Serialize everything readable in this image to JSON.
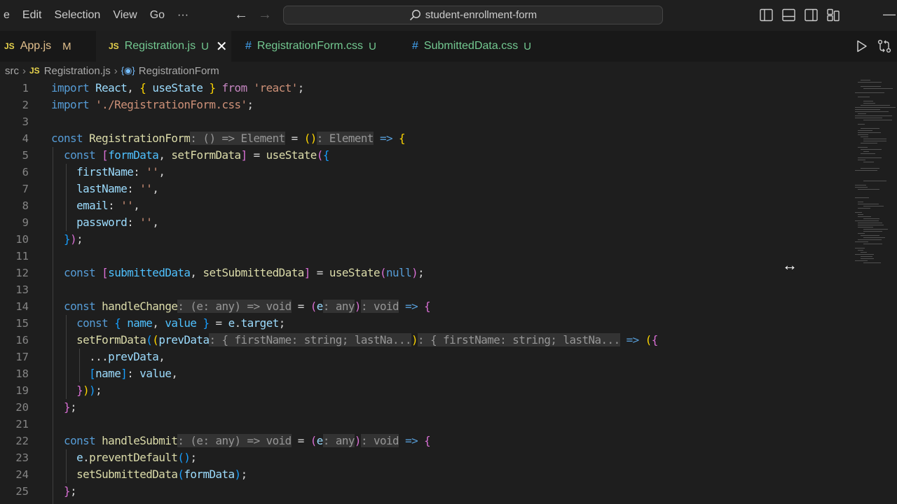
{
  "menu": [
    "e",
    "Edit",
    "Selection",
    "View",
    "Go",
    "···"
  ],
  "search": {
    "text": "student-enrollment-form",
    "icon": "search-icon"
  },
  "window_controls": {
    "minimize": "—"
  },
  "tabs": [
    {
      "icon": "JS",
      "name": "App.js",
      "status": "M",
      "active": false
    },
    {
      "icon": "JS",
      "name": "Registration.js",
      "status": "U",
      "active": true,
      "close": "✕"
    },
    {
      "icon": "#",
      "name": "RegistrationForm.css",
      "status": "U",
      "active": false
    },
    {
      "icon": "#",
      "name": "SubmittedData.css",
      "status": "U",
      "active": false
    }
  ],
  "breadcrumbs": {
    "folder": "src",
    "file_icon": "JS",
    "file": "Registration.js",
    "symbol_icon": "{◉}",
    "symbol": "RegistrationForm"
  },
  "line_numbers": [
    "1",
    "2",
    "3",
    "4",
    "5",
    "6",
    "7",
    "8",
    "9",
    "10",
    "11",
    "12",
    "13",
    "14",
    "15",
    "16",
    "17",
    "18",
    "19",
    "20",
    "21",
    "22",
    "23",
    "24",
    "25"
  ],
  "code": [
    [
      [
        "kw",
        "import "
      ],
      [
        "var",
        "React"
      ],
      [
        "pl",
        ", "
      ],
      [
        "br1",
        "{"
      ],
      [
        "var",
        " useState "
      ],
      [
        "br1",
        "}"
      ],
      [
        "ctl",
        " from "
      ],
      [
        "str",
        "'react'"
      ],
      [
        "pl",
        ";"
      ]
    ],
    [
      [
        "kw",
        "import "
      ],
      [
        "str",
        "'./RegistrationForm.css'"
      ],
      [
        "pl",
        ";"
      ]
    ],
    [],
    [
      [
        "kw",
        "const "
      ],
      [
        "fn",
        "RegistrationForm"
      ],
      [
        "hint",
        ": () => Element"
      ],
      [
        "pl",
        " = "
      ],
      [
        "br1",
        "()"
      ],
      [
        "hint",
        ": Element"
      ],
      [
        "kw",
        " => "
      ],
      [
        "br1",
        "{"
      ]
    ],
    [
      [
        "pl",
        "  "
      ],
      [
        "kw",
        "const "
      ],
      [
        "br2",
        "["
      ],
      [
        "cst",
        "formData"
      ],
      [
        "pl",
        ", "
      ],
      [
        "fn",
        "setFormData"
      ],
      [
        "br2",
        "]"
      ],
      [
        "pl",
        " = "
      ],
      [
        "fn",
        "useState"
      ],
      [
        "br2",
        "("
      ],
      [
        "br3",
        "{"
      ]
    ],
    [
      [
        "pl",
        "    "
      ],
      [
        "var",
        "firstName"
      ],
      [
        "pl",
        ": "
      ],
      [
        "str",
        "''"
      ],
      [
        "pl",
        ","
      ]
    ],
    [
      [
        "pl",
        "    "
      ],
      [
        "var",
        "lastName"
      ],
      [
        "pl",
        ": "
      ],
      [
        "str",
        "''"
      ],
      [
        "pl",
        ","
      ]
    ],
    [
      [
        "pl",
        "    "
      ],
      [
        "var",
        "email"
      ],
      [
        "pl",
        ": "
      ],
      [
        "str",
        "''"
      ],
      [
        "pl",
        ","
      ]
    ],
    [
      [
        "pl",
        "    "
      ],
      [
        "var",
        "password"
      ],
      [
        "pl",
        ": "
      ],
      [
        "str",
        "''"
      ],
      [
        "pl",
        ","
      ]
    ],
    [
      [
        "pl",
        "  "
      ],
      [
        "br3",
        "}"
      ],
      [
        "br2",
        ")"
      ],
      [
        "pl",
        ";"
      ]
    ],
    [],
    [
      [
        "pl",
        "  "
      ],
      [
        "kw",
        "const "
      ],
      [
        "br2",
        "["
      ],
      [
        "cst",
        "submittedData"
      ],
      [
        "pl",
        ", "
      ],
      [
        "fn",
        "setSubmittedData"
      ],
      [
        "br2",
        "]"
      ],
      [
        "pl",
        " = "
      ],
      [
        "fn",
        "useState"
      ],
      [
        "br2",
        "("
      ],
      [
        "kw",
        "null"
      ],
      [
        "br2",
        ")"
      ],
      [
        "pl",
        ";"
      ]
    ],
    [],
    [
      [
        "pl",
        "  "
      ],
      [
        "kw",
        "const "
      ],
      [
        "fn",
        "handleChange"
      ],
      [
        "hint",
        ": (e: any) => void"
      ],
      [
        "pl",
        " = "
      ],
      [
        "br2",
        "("
      ],
      [
        "var",
        "e"
      ],
      [
        "hint",
        ": any"
      ],
      [
        "br2",
        ")"
      ],
      [
        "hint",
        ": void"
      ],
      [
        "kw",
        " => "
      ],
      [
        "br2",
        "{"
      ]
    ],
    [
      [
        "pl",
        "    "
      ],
      [
        "kw",
        "const "
      ],
      [
        "br3",
        "{"
      ],
      [
        "cst",
        " name"
      ],
      [
        "pl",
        ", "
      ],
      [
        "cst",
        "value "
      ],
      [
        "br3",
        "}"
      ],
      [
        "pl",
        " = "
      ],
      [
        "var",
        "e"
      ],
      [
        "pl",
        "."
      ],
      [
        "var",
        "target"
      ],
      [
        "pl",
        ";"
      ]
    ],
    [
      [
        "pl",
        "    "
      ],
      [
        "fn",
        "setFormData"
      ],
      [
        "br3",
        "("
      ],
      [
        "br1",
        "("
      ],
      [
        "var",
        "prevData"
      ],
      [
        "hint",
        ": { firstName: string; lastNa..."
      ],
      [
        "br1",
        ")"
      ],
      [
        "hint",
        ": { firstName: string; lastNa..."
      ],
      [
        "kw",
        " => "
      ],
      [
        "br1",
        "("
      ],
      [
        "br2",
        "{"
      ]
    ],
    [
      [
        "pl",
        "      ..."
      ],
      [
        "var",
        "prevData"
      ],
      [
        "pl",
        ","
      ]
    ],
    [
      [
        "pl",
        "      "
      ],
      [
        "br3",
        "["
      ],
      [
        "var",
        "name"
      ],
      [
        "br3",
        "]"
      ],
      [
        "pl",
        ": "
      ],
      [
        "var",
        "value"
      ],
      [
        "pl",
        ","
      ]
    ],
    [
      [
        "pl",
        "    "
      ],
      [
        "br2",
        "}"
      ],
      [
        "br1",
        ")"
      ],
      [
        "br3",
        ")"
      ],
      [
        "pl",
        ";"
      ]
    ],
    [
      [
        "pl",
        "  "
      ],
      [
        "br2",
        "}"
      ],
      [
        "pl",
        ";"
      ]
    ],
    [],
    [
      [
        "pl",
        "  "
      ],
      [
        "kw",
        "const "
      ],
      [
        "fn",
        "handleSubmit"
      ],
      [
        "hint",
        ": (e: any) => void"
      ],
      [
        "pl",
        " = "
      ],
      [
        "br2",
        "("
      ],
      [
        "var",
        "e"
      ],
      [
        "hint",
        ": any"
      ],
      [
        "br2",
        ")"
      ],
      [
        "hint",
        ": void"
      ],
      [
        "kw",
        " => "
      ],
      [
        "br2",
        "{"
      ]
    ],
    [
      [
        "pl",
        "    "
      ],
      [
        "var",
        "e"
      ],
      [
        "pl",
        "."
      ],
      [
        "fn",
        "preventDefault"
      ],
      [
        "br3",
        "()"
      ],
      [
        "pl",
        ";"
      ]
    ],
    [
      [
        "pl",
        "    "
      ],
      [
        "fn",
        "setSubmittedData"
      ],
      [
        "br3",
        "("
      ],
      [
        "var",
        "formData"
      ],
      [
        "br3",
        ")"
      ],
      [
        "pl",
        ";"
      ]
    ],
    [
      [
        "pl",
        "  "
      ],
      [
        "br2",
        "}"
      ],
      [
        "pl",
        ";"
      ]
    ]
  ],
  "colors": {
    "keyword": "#569cd6",
    "control": "#c586c0",
    "function": "#dcdcaa",
    "variable": "#9cdcfe",
    "constant": "#4fc1ff",
    "string": "#ce9178",
    "bracket1": "#ffd700",
    "bracket2": "#da70d6",
    "bracket3": "#179fff",
    "modified": "#e2c08d",
    "untracked": "#73c991"
  }
}
